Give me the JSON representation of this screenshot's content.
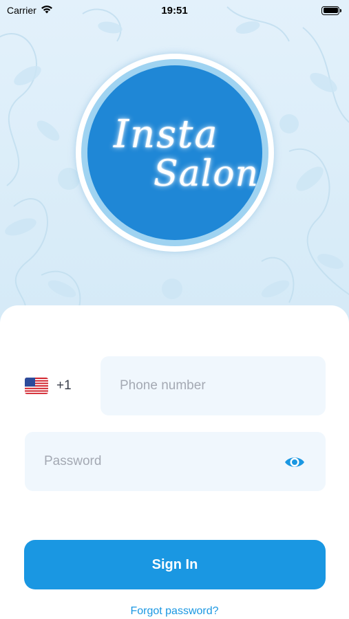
{
  "status_bar": {
    "carrier": "Carrier",
    "time": "19:51"
  },
  "logo": {
    "line1": "Insta",
    "line2": "Salon"
  },
  "login": {
    "country_flag": "us-flag-icon",
    "dial_code": "+1",
    "phone_placeholder": "Phone number",
    "password_placeholder": "Password",
    "toggle_visibility_icon": "eye-icon",
    "sign_in_label": "Sign In",
    "forgot_password_label": "Forgot password?"
  },
  "colors": {
    "accent": "#1a97e2",
    "logo_blue": "#1f87d6",
    "field_bg": "#f0f7fd",
    "background": "#dcedf8"
  }
}
